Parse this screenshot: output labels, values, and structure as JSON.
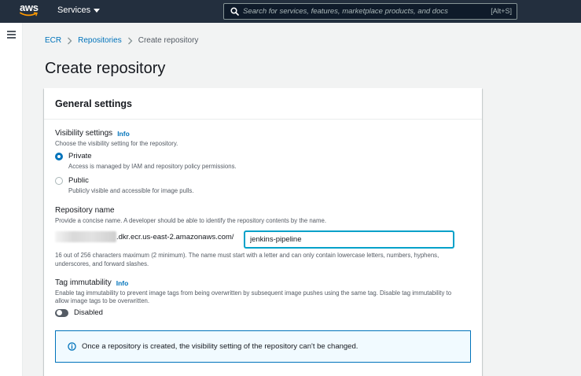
{
  "topnav": {
    "logo_text": "aws",
    "services_label": "Services",
    "search_placeholder": "Search for services, features, marketplace products, and docs",
    "search_shortcut": "[Alt+S]"
  },
  "breadcrumb": {
    "items": [
      "ECR",
      "Repositories",
      "Create repository"
    ]
  },
  "page": {
    "title": "Create repository"
  },
  "general_settings": {
    "title": "General settings",
    "visibility": {
      "label": "Visibility settings",
      "info": "Info",
      "description": "Choose the visibility setting for the repository.",
      "options": [
        {
          "label": "Private",
          "description": "Access is managed by IAM and repository policy permissions.",
          "selected": true
        },
        {
          "label": "Public",
          "description": "Publicly visible and accessible for image pulls.",
          "selected": false
        }
      ]
    },
    "repository_name": {
      "label": "Repository name",
      "description": "Provide a concise name. A developer should be able to identify the repository contents by the name.",
      "uri_suffix": ".dkr.ecr.us-east-2.amazonaws.com/",
      "value": "jenkins-pipeline",
      "constraint": "16 out of 256 characters maximum (2 minimum). The name must start with a letter and can only contain lowercase letters, numbers, hyphens, underscores, and forward slashes."
    },
    "tag_immutability": {
      "label": "Tag immutability",
      "info": "Info",
      "description": "Enable tag immutability to prevent image tags from being overwritten by subsequent image pushes using the same tag. Disable tag immutability to allow image tags to be overwritten.",
      "state_label": "Disabled"
    },
    "alert": {
      "text": "Once a repository is created, the visibility setting of the repository can't be changed."
    }
  },
  "colors": {
    "nav_bg": "#232f3e",
    "link": "#0073bb",
    "logo_smile": "#ff9900",
    "alert_bg": "#f1faff"
  }
}
